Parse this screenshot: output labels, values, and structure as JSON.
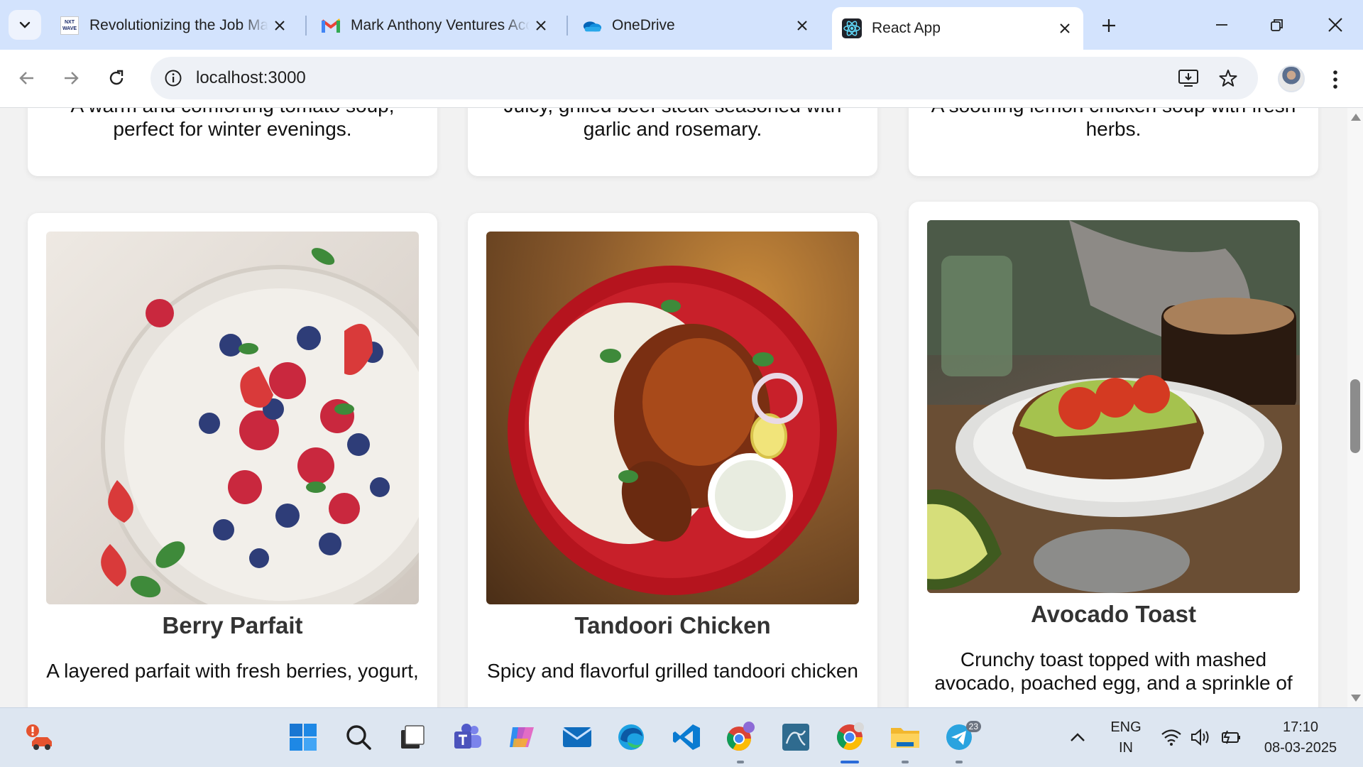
{
  "browser": {
    "tabs": [
      {
        "title": "Revolutionizing the Job Market",
        "favicon": "nxtwave-icon",
        "favicon_text": "NXT WAVE",
        "active": false
      },
      {
        "title": "Mark Anthony Ventures Accounts",
        "favicon": "gmail-icon",
        "active": false
      },
      {
        "title": "OneDrive",
        "favicon": "onedrive-icon",
        "active": false
      },
      {
        "title": "React App",
        "favicon": "react-icon",
        "active": true
      }
    ],
    "url": "localhost:3000",
    "colors": {
      "tabstrip": "#d3e3fd",
      "active_tab": "#ffffff",
      "omnibox": "#eef1f6"
    }
  },
  "page": {
    "top_cards": [
      {
        "desc_partial": "A warm and comforting tomato soup,",
        "desc_end": "perfect for winter evenings."
      },
      {
        "desc_partial": "Juicy, grilled beef steak seasoned with",
        "desc_end": "garlic and rosemary."
      },
      {
        "desc_partial": "A soothing lemon chicken soup with fresh",
        "desc_end": "herbs."
      }
    ],
    "cards": [
      {
        "name": "Berry Parfait",
        "desc": "A layered parfait with fresh berries, yogurt,",
        "image": "berry-parfait-photo"
      },
      {
        "name": "Tandoori Chicken",
        "desc": "Spicy and flavorful grilled tandoori chicken",
        "image": "tandoori-chicken-photo"
      },
      {
        "name": "Avocado Toast",
        "desc_line1": "Crunchy toast topped with mashed",
        "desc_line2": "avocado, poached egg, and a sprinkle of",
        "image": "avocado-toast-photo"
      }
    ]
  },
  "taskbar": {
    "language": "ENG",
    "region": "IN",
    "time": "17:10",
    "date": "08-03-2025",
    "telegram_badge": "23",
    "accent": "#2a6ad8"
  }
}
